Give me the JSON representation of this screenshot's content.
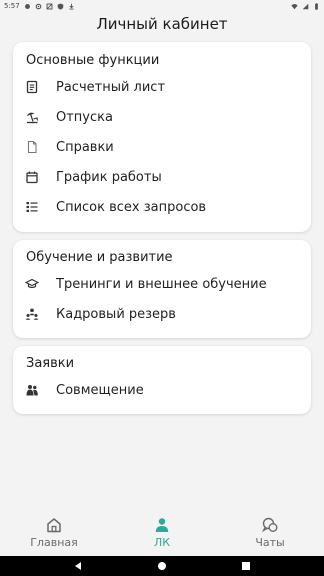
{
  "status_bar": {
    "time": "5:57",
    "icons": [
      "status-dot-icon",
      "settings-icon",
      "block-icon",
      "shield-icon",
      "download-icon"
    ],
    "right_icons": [
      "wifi-icon",
      "signal-icon",
      "battery-icon"
    ]
  },
  "header": {
    "title": "Личный кабинет"
  },
  "sections": [
    {
      "title": "Основные функции",
      "items": [
        {
          "label": "Расчетный лист",
          "icon": "payslip-icon"
        },
        {
          "label": "Отпуска",
          "icon": "beach-umbrella-icon"
        },
        {
          "label": "Справки",
          "icon": "document-icon"
        },
        {
          "label": "График работы",
          "icon": "calendar-icon"
        },
        {
          "label": "Список всех запросов",
          "icon": "list-icon"
        }
      ]
    },
    {
      "title": "Обучение и развитие",
      "items": [
        {
          "label": "Тренинги и внешнее обучение",
          "icon": "graduation-cap-icon"
        },
        {
          "label": "Кадровый резерв",
          "icon": "team-icon"
        }
      ]
    },
    {
      "title": "Заявки",
      "items": [
        {
          "label": "Совмещение",
          "icon": "people-icon"
        }
      ]
    }
  ],
  "bottom_nav": {
    "items": [
      {
        "label": "Главная",
        "icon": "home-icon",
        "active": false
      },
      {
        "label": "ЛК",
        "icon": "person-icon",
        "active": true
      },
      {
        "label": "Чаты",
        "icon": "chat-icon",
        "active": false
      }
    ],
    "active_color": "#2ea89b",
    "inactive_color": "#6b6b6b"
  },
  "system_nav": {
    "buttons": [
      "back-icon",
      "home-circle-icon",
      "recents-icon"
    ]
  }
}
